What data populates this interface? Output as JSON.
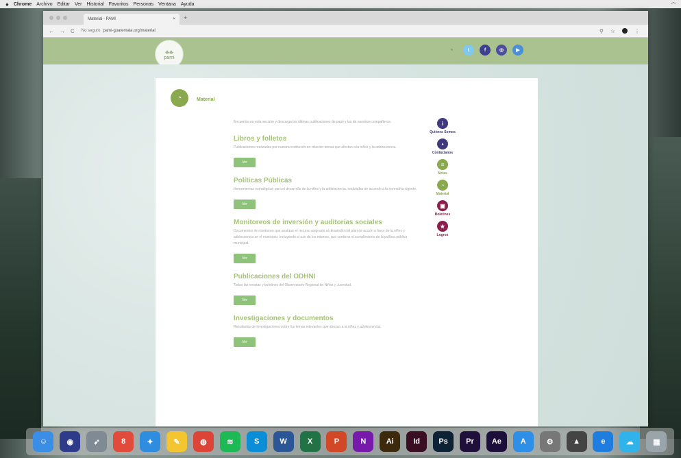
{
  "os": {
    "menu": [
      "Chrome",
      "Archivo",
      "Editar",
      "Ver",
      "Historial",
      "Favoritos",
      "Personas",
      "Ventana",
      "Ayuda"
    ]
  },
  "browser": {
    "tab_title": "Material - PAMI",
    "url_insecure": "No seguro",
    "url": "pami-guatemala.org/material"
  },
  "site": {
    "logo_text": "pami",
    "socials": [
      {
        "icon": "twitter-icon",
        "glyph": "t",
        "color": "#7fc9ec"
      },
      {
        "icon": "facebook-icon",
        "glyph": "f",
        "color": "#3d3f8f"
      },
      {
        "icon": "instagram-icon",
        "glyph": "◎",
        "color": "#4b4f9c"
      },
      {
        "icon": "youtube-icon",
        "glyph": "▶",
        "color": "#4a8fd8"
      }
    ],
    "page_title": "Material",
    "intro": "Encuentra en esta sección y descarga las últimas publicaciones de pami y las de nuestros compañeros.",
    "button_label": "Ver",
    "sections": [
      {
        "title": "Libros y folletos",
        "text": "Publicaciones realizadas por nuestra institución en relación temas que afectan a la niñez y la adolescencia."
      },
      {
        "title": "Políticas Públicas",
        "text": "Herramientas estratégicas para el desarrollo de la niñez y la adolescencia, realizadas de acuerdo a la normativa vigente."
      },
      {
        "title": "Monitoreos de inversión y auditorías sociales",
        "text": "Documentos de monitoreo que analizan el recurso asignado al desarrollo del plan de acción a favor de la niñez y adolescencia en el municipio. Incluyendo el uso de los mismos, que contiene el cumplimiento de la política pública municipal."
      },
      {
        "title": "Publicaciones del ODHNI",
        "text": "Todas las revistas y boletines del Observatorio Regional de Niñez y Juventud."
      },
      {
        "title": "Investigaciones y documentos",
        "text": "Resultados de investigaciones sobre los temas relevantes que afectan a la niñez y adolescencia."
      }
    ],
    "sidenav": [
      {
        "label": "Quiénes Somos",
        "icon": "info-icon",
        "glyph": "i",
        "color": "#3e3a7d"
      },
      {
        "label": "Contáctanos",
        "icon": "chat-icon",
        "glyph": "•",
        "color": "#3e3a7d"
      },
      {
        "label": "Notas",
        "icon": "notes-icon",
        "glyph": "≡",
        "color": "#8aa84e"
      },
      {
        "label": "Material",
        "icon": "material-icon",
        "glyph": "◔",
        "color": "#8aa84e"
      },
      {
        "label": "Boletines",
        "icon": "newsletter-icon",
        "glyph": "▣",
        "color": "#8a1f4d"
      },
      {
        "label": "Logros",
        "icon": "achievement-icon",
        "glyph": "★",
        "color": "#8a1f4d"
      }
    ]
  },
  "dock": [
    {
      "name": "finder-icon",
      "glyph": "☺",
      "color": "#3a8ee6"
    },
    {
      "name": "siri-icon",
      "glyph": "◉",
      "color": "#2e3a8a"
    },
    {
      "name": "launchpad-icon",
      "glyph": "➶",
      "color": "#7f8a94"
    },
    {
      "name": "calendar-icon",
      "glyph": "8",
      "color": "#e24a3b"
    },
    {
      "name": "safari-icon",
      "glyph": "✦",
      "color": "#2f8de0"
    },
    {
      "name": "notes-app-icon",
      "glyph": "✎",
      "color": "#f2c531"
    },
    {
      "name": "chrome-icon",
      "glyph": "◍",
      "color": "#db4437"
    },
    {
      "name": "spotify-icon",
      "glyph": "≋",
      "color": "#1db954"
    },
    {
      "name": "skype-icon",
      "glyph": "S",
      "color": "#0a8ed8"
    },
    {
      "name": "word-icon",
      "glyph": "W",
      "color": "#2b5797"
    },
    {
      "name": "excel-icon",
      "glyph": "X",
      "color": "#217346"
    },
    {
      "name": "powerpoint-icon",
      "glyph": "P",
      "color": "#d24726"
    },
    {
      "name": "onenote-icon",
      "glyph": "N",
      "color": "#7719aa"
    },
    {
      "name": "illustrator-icon",
      "glyph": "Ai",
      "color": "#3d2a0d"
    },
    {
      "name": "indesign-icon",
      "glyph": "Id",
      "color": "#3b0f23"
    },
    {
      "name": "photoshop-icon",
      "glyph": "Ps",
      "color": "#0d2235"
    },
    {
      "name": "premiere-icon",
      "glyph": "Pr",
      "color": "#1f0f3b"
    },
    {
      "name": "aftereffects-icon",
      "glyph": "Ae",
      "color": "#1d0f3b"
    },
    {
      "name": "appstore-icon",
      "glyph": "A",
      "color": "#2e8fe8"
    },
    {
      "name": "preferences-icon",
      "glyph": "⚙",
      "color": "#777"
    },
    {
      "name": "unknown-app-icon",
      "glyph": "▲",
      "color": "#444"
    },
    {
      "name": "edge-icon",
      "glyph": "e",
      "color": "#1f7de0"
    },
    {
      "name": "finder-alt-icon",
      "glyph": "☁",
      "color": "#2fb3ea"
    },
    {
      "name": "trash-icon",
      "glyph": "▦",
      "color": "#9aa4ab"
    }
  ]
}
